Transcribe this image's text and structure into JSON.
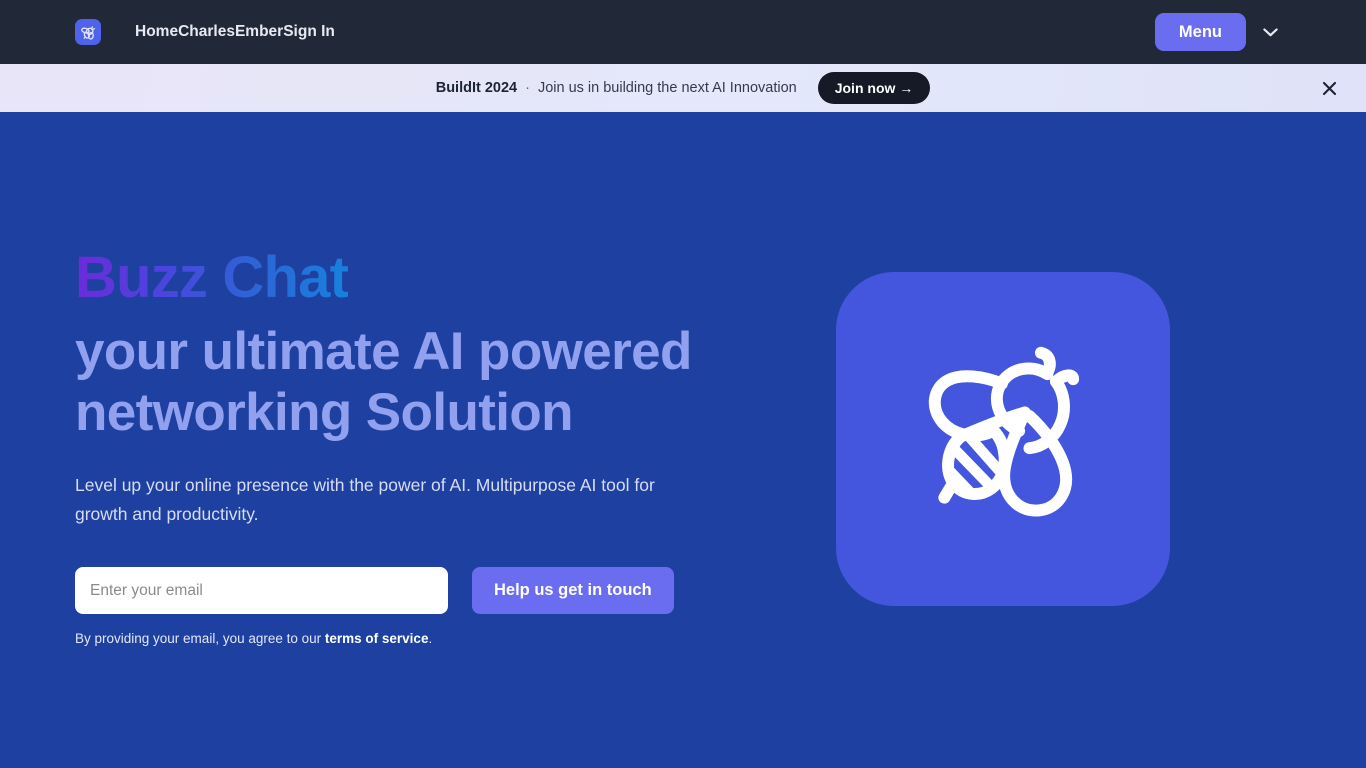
{
  "navbar": {
    "logo_icon": "bee-logo-icon",
    "links": [
      {
        "label": "Home"
      },
      {
        "label": "Charles"
      },
      {
        "label": "Ember"
      },
      {
        "label": "Sign In"
      }
    ],
    "menu_label": "Menu",
    "menu_caret_icon": "chevron-down-icon"
  },
  "banner": {
    "title": "BuildIt 2024",
    "separator": "·",
    "text": "Join us in building the next AI Innovation",
    "cta_label": "Join now →",
    "close_icon": "close-icon",
    "background_start": "#e9e5f8",
    "background_end": "#dfe2f8",
    "cta_color": "#151a26"
  },
  "hero": {
    "brand": "Buzz Chat",
    "brand_gradient_start": "#6b2bd9",
    "brand_gradient_end": "#1881dd",
    "heading": "your ultimate AI powered networking Solution",
    "heading_color": "#92a1ef",
    "subtext": "Level up your online presence with the power of AI. Multipurpose AI tool for growth and productivity.",
    "background_color": "#1e40a0",
    "form": {
      "email_placeholder": "Enter your email",
      "email_value": "",
      "submit_label": "Help us get in touch",
      "submit_color": "#6a6df0"
    },
    "terms": {
      "prefix": "By providing your email, you agree to our ",
      "link_label": "terms of service",
      "suffix": "."
    },
    "illustration": {
      "icon": "bee-icon",
      "card_color": "#4456dd",
      "stroke_color": "#ffffff"
    }
  }
}
